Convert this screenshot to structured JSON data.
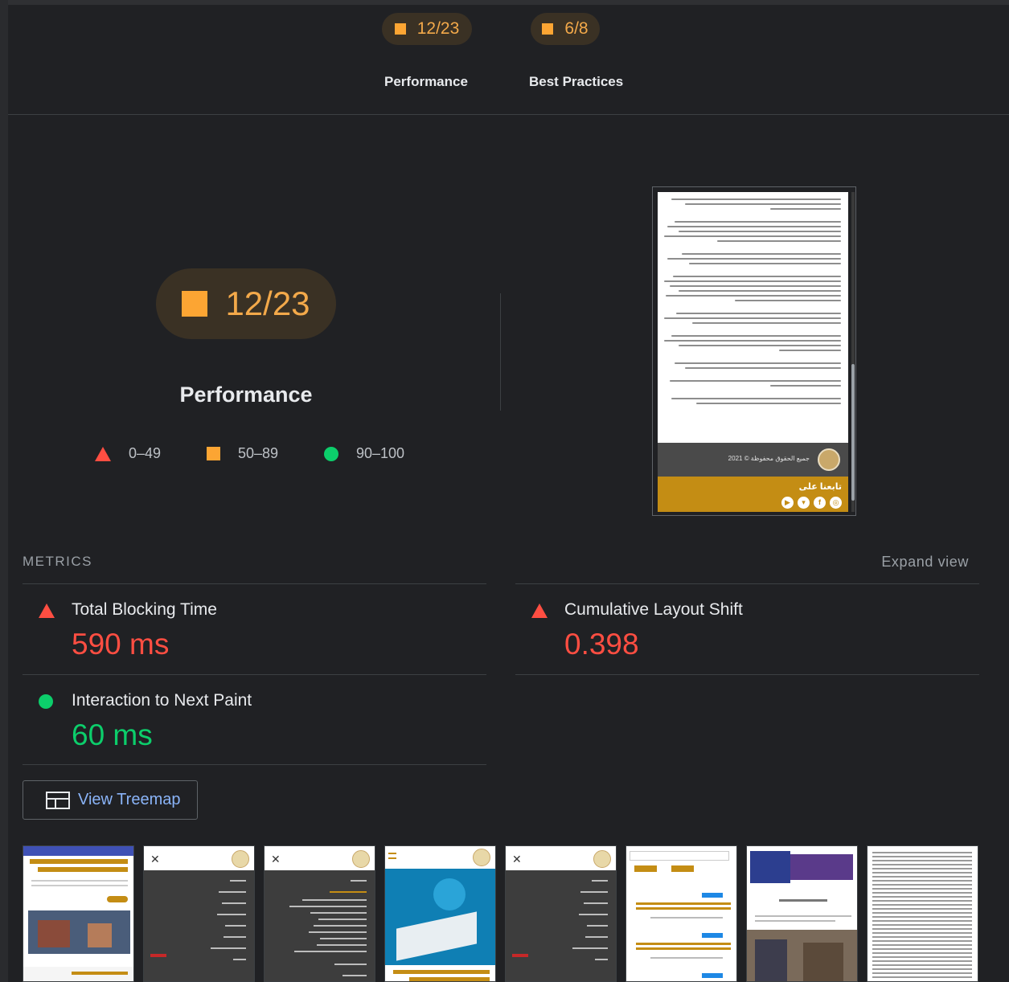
{
  "summary": {
    "gauges": [
      {
        "score": "12/23",
        "label": "Performance"
      },
      {
        "score": "6/8",
        "label": "Best Practices"
      }
    ]
  },
  "performance": {
    "score": "12/23",
    "title": "Performance",
    "legend": [
      {
        "shape": "triangle",
        "range": "0–49",
        "color": "#ff4e42"
      },
      {
        "shape": "square",
        "range": "50–89",
        "color": "#fca533"
      },
      {
        "shape": "circle",
        "range": "90–100",
        "color": "#0cce6b"
      }
    ]
  },
  "screenshot": {
    "copyright": "جميع الحقوق محفوظة © 2021",
    "follow_label": "تابعنا على",
    "social_icons": [
      "youtube-icon",
      "twitter-icon",
      "facebook-icon",
      "instagram-icon"
    ]
  },
  "metrics": {
    "heading": "METRICS",
    "expand_label": "Expand view",
    "items": [
      {
        "name": "Total Blocking Time",
        "value": "590 ms",
        "status": "fail"
      },
      {
        "name": "Cumulative Layout Shift",
        "value": "0.398",
        "status": "fail"
      },
      {
        "name": "Interaction to Next Paint",
        "value": "60 ms",
        "status": "pass"
      }
    ]
  },
  "treemap": {
    "label": "View Treemap"
  },
  "colors": {
    "fail": "#ff4e42",
    "average": "#fca533",
    "pass": "#0cce6b",
    "link": "#8ab4f8"
  }
}
